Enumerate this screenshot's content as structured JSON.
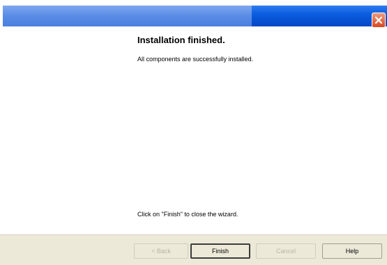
{
  "window": {
    "close_icon": "close-x-icon"
  },
  "content": {
    "heading": "Installation finished.",
    "subtext": "All components are successfully installed.",
    "footer_text": "Click on \"Finish\" to close the wizard."
  },
  "buttons": {
    "back_label": "< Back",
    "finish_label": "Finish",
    "cancel_label": "Cancel",
    "help_label": "Help"
  },
  "colors": {
    "titlebar": "#0b5ee0",
    "close_button": "#d9471f",
    "button_bar": "#ece9d8"
  }
}
